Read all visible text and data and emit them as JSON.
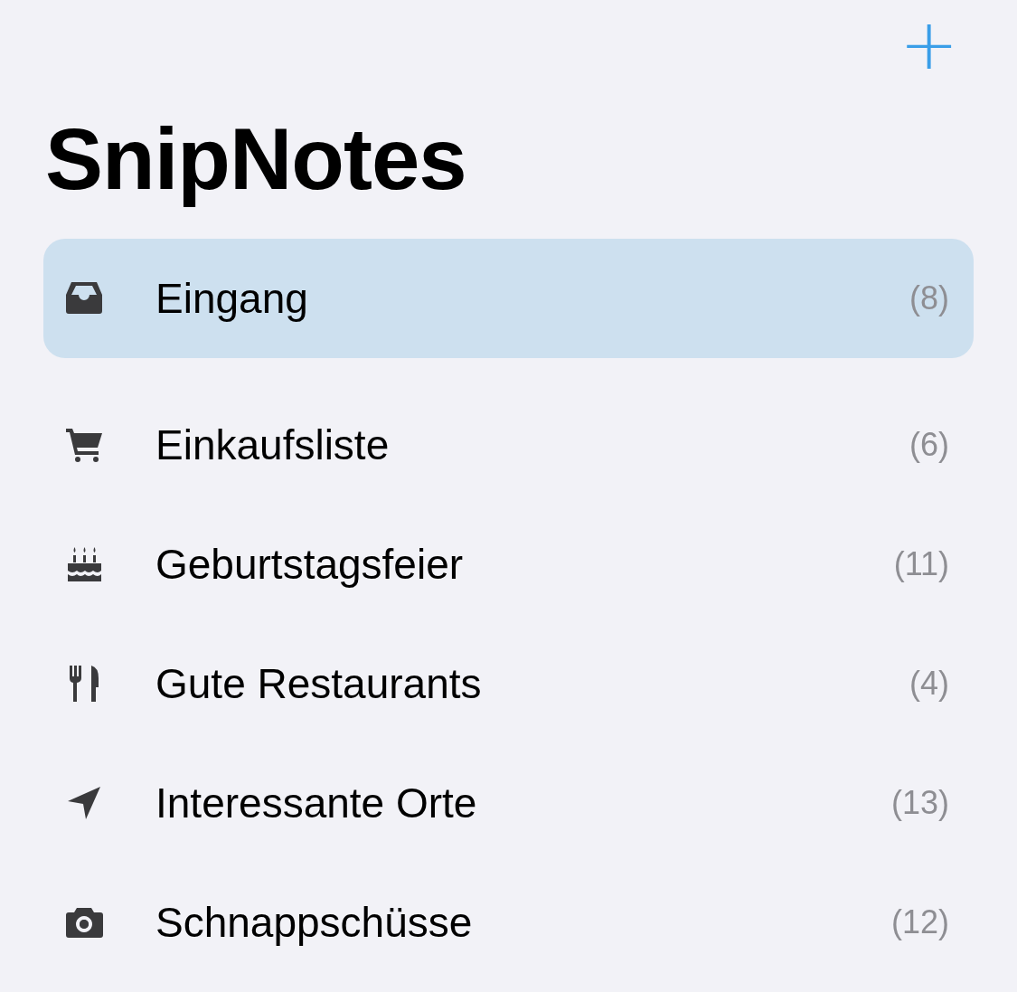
{
  "title": "SnipNotes",
  "add_button": {
    "label": "+"
  },
  "folders": [
    {
      "kind": "tray",
      "name": "Eingang",
      "count": "(8)",
      "selected": true
    },
    {
      "kind": "cart",
      "name": "Einkaufsliste",
      "count": "(6)",
      "selected": false
    },
    {
      "kind": "cake",
      "name": "Geburtstagsfeier",
      "count": "(11)",
      "selected": false
    },
    {
      "kind": "cutlery",
      "name": "Gute Restaurants",
      "count": "(4)",
      "selected": false
    },
    {
      "kind": "location",
      "name": "Interessante Orte",
      "count": "(13)",
      "selected": false
    },
    {
      "kind": "camera",
      "name": "Schnappschüsse",
      "count": "(12)",
      "selected": false
    }
  ]
}
